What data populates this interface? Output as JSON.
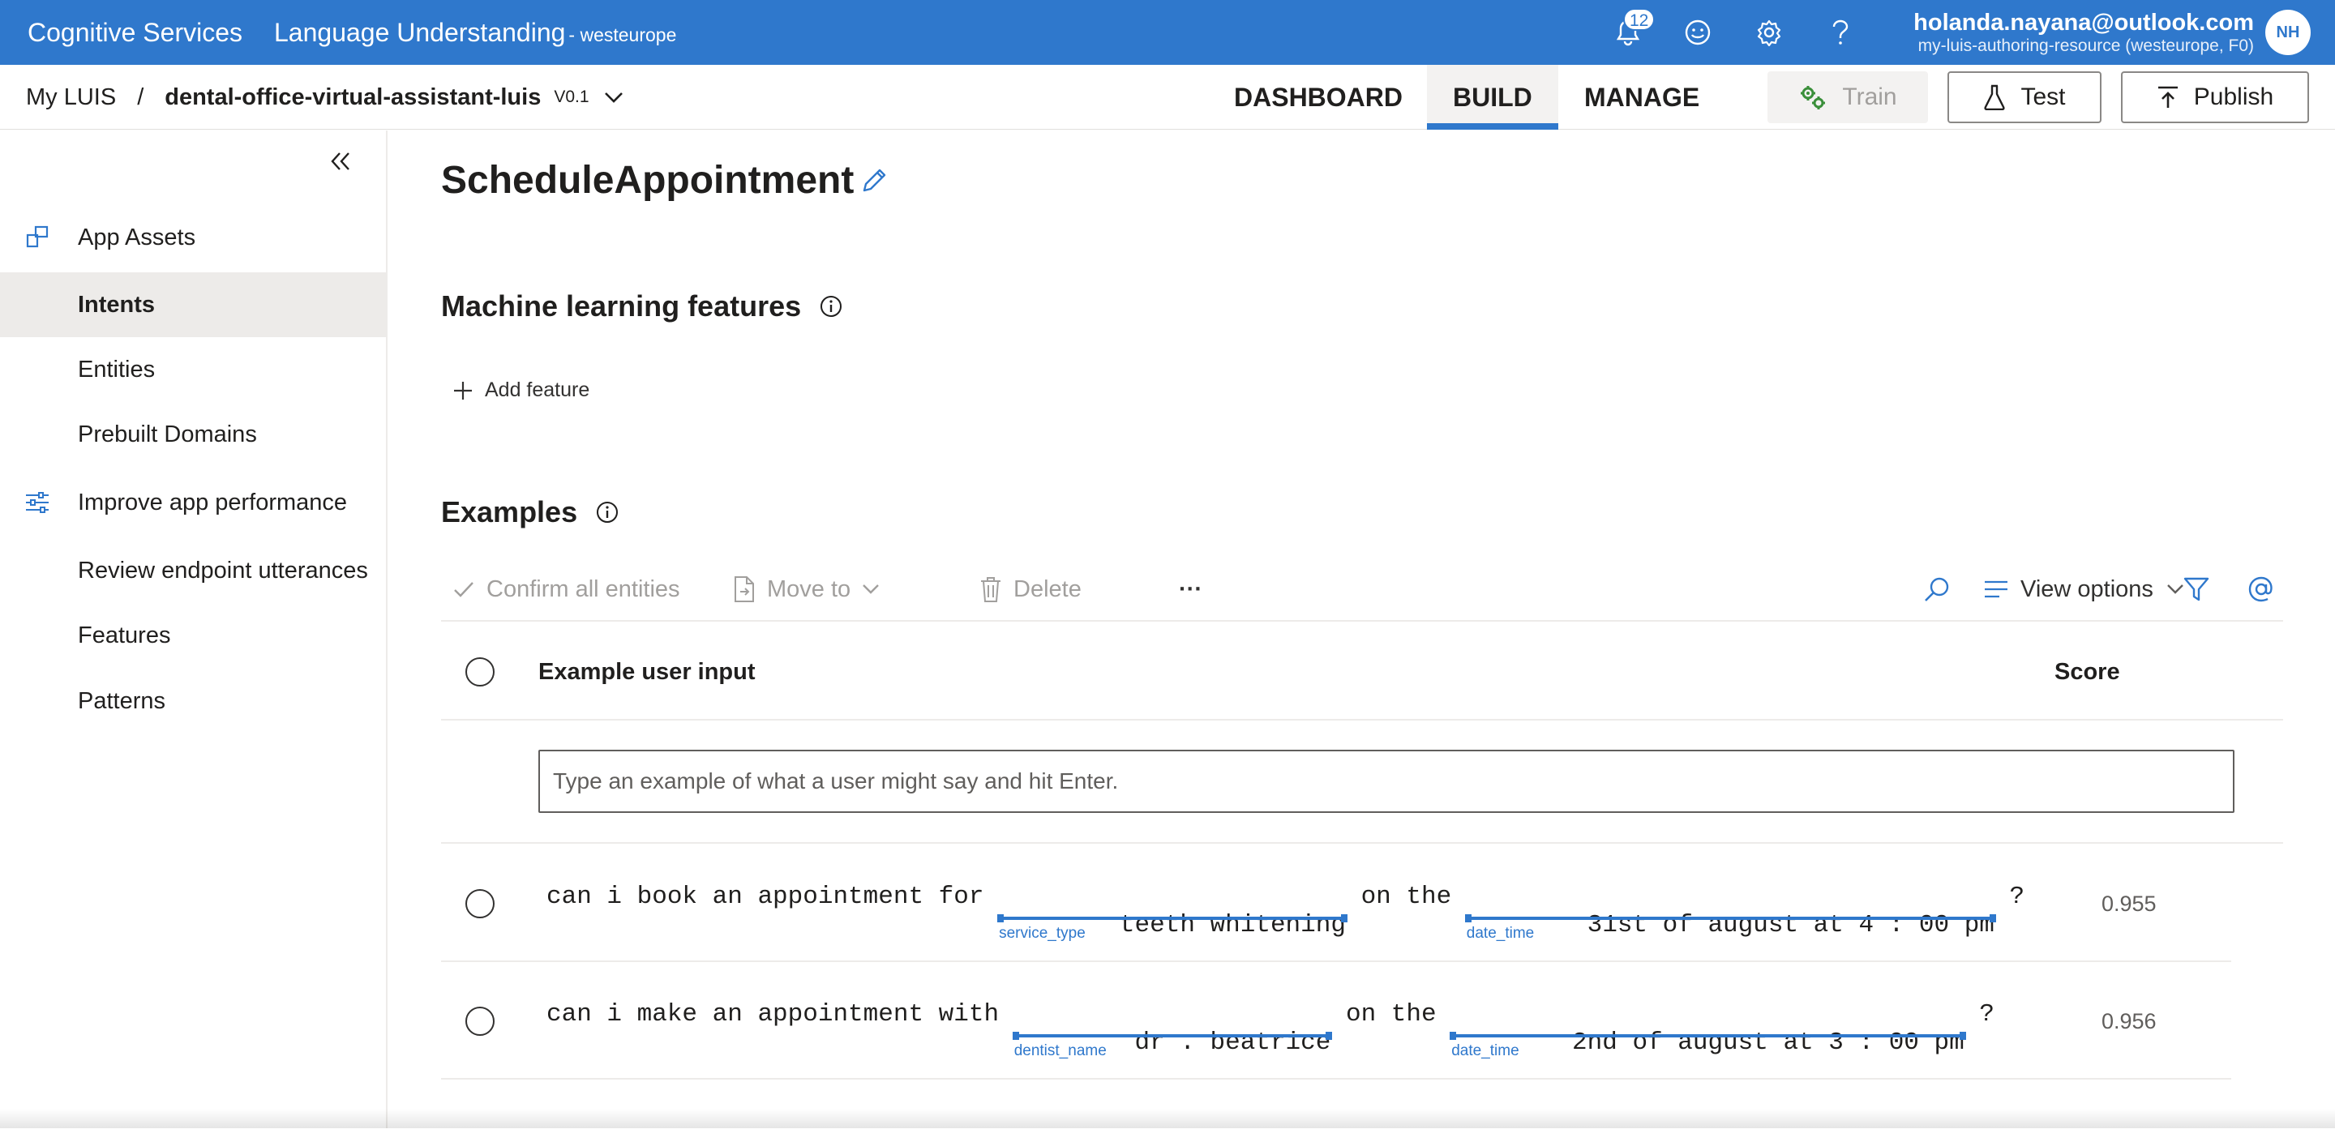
{
  "topbar": {
    "brand": "Cognitive Services",
    "product": "Language Understanding",
    "region": "- westeurope",
    "notification_count": "12",
    "user_email": "holanda.nayana@outlook.com",
    "user_resource": "my-luis-authoring-resource (westeurope, F0)",
    "avatar_initials": "NH",
    "icons": [
      "bell-icon",
      "smiley-icon",
      "gear-icon",
      "help-icon"
    ]
  },
  "subbar": {
    "breadcrumb_root": "My LUIS",
    "breadcrumb_sep": "/",
    "app_name": "dental-office-virtual-assistant-luis",
    "version": "V0.1",
    "tabs": [
      {
        "label": "DASHBOARD"
      },
      {
        "label": "BUILD"
      },
      {
        "label": "MANAGE"
      }
    ],
    "active_tab": "BUILD",
    "train_label": "Train",
    "test_label": "Test",
    "publish_label": "Publish"
  },
  "sidebar": {
    "items": [
      {
        "label": "App Assets",
        "icon": "app-assets-icon"
      },
      {
        "label": "Intents"
      },
      {
        "label": "Entities"
      },
      {
        "label": "Prebuilt Domains"
      },
      {
        "label": "Improve app performance",
        "icon": "sliders-icon"
      },
      {
        "label": "Review endpoint utterances"
      },
      {
        "label": "Features"
      },
      {
        "label": "Patterns"
      }
    ],
    "active_item": "Intents"
  },
  "main": {
    "title": "ScheduleAppointment",
    "ml_features_heading": "Machine learning features",
    "add_feature_label": "Add feature",
    "examples_heading": "Examples",
    "commands": {
      "confirm_all": "Confirm all entities",
      "move_to": "Move to",
      "delete": "Delete",
      "more": "···",
      "view_options": "View options"
    },
    "table": {
      "col_input": "Example user input",
      "col_score": "Score",
      "input_placeholder": "Type an example of what a user might say and hit Enter.",
      "rows": [
        {
          "parts": [
            {
              "text": "can i book an appointment for "
            },
            {
              "text": "teeth whitening",
              "entity": "service_type"
            },
            {
              "text": " on the "
            },
            {
              "text": "31st of august at 4 : 00 pm",
              "entity": "date_time"
            },
            {
              "text": " ?"
            }
          ],
          "score": "0.955"
        },
        {
          "parts": [
            {
              "text": "can i make an appointment with "
            },
            {
              "text": "dr . beatrice",
              "entity": "dentist_name"
            },
            {
              "text": " on the "
            },
            {
              "text": "2nd of august at 3 : 00 pm",
              "entity": "date_time"
            },
            {
              "text": " ?"
            }
          ],
          "score": "0.956"
        }
      ]
    }
  },
  "colors": {
    "brand_blue": "#2f78cc",
    "selected_bg": "#edebe9"
  }
}
